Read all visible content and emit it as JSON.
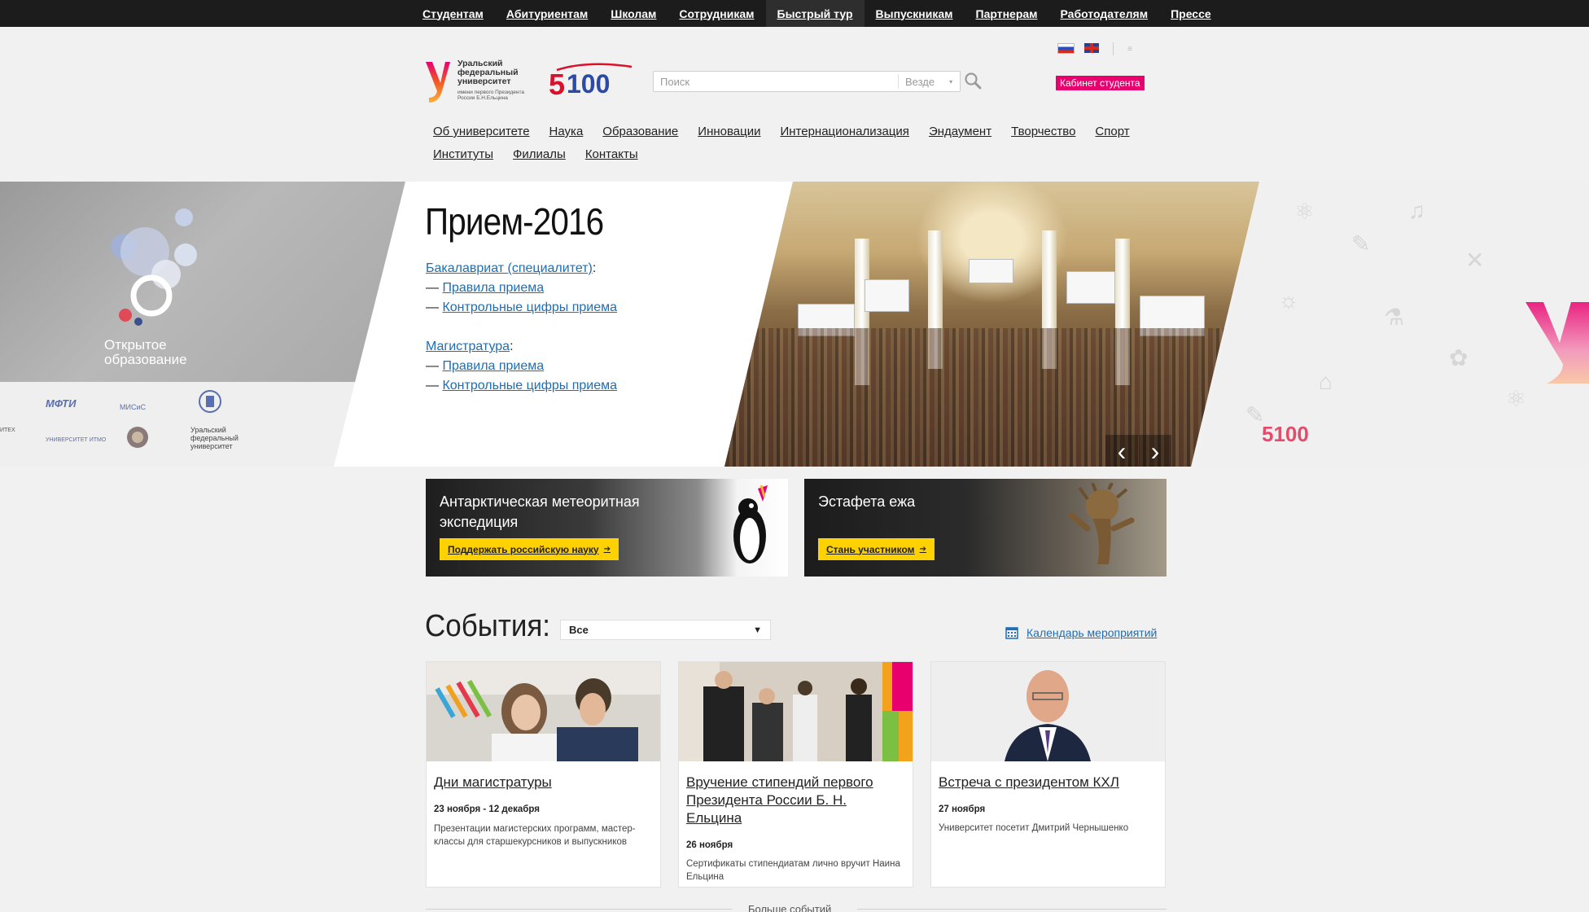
{
  "topbar": {
    "items": [
      {
        "label": "Студентам"
      },
      {
        "label": "Абитуриентам"
      },
      {
        "label": "Школам"
      },
      {
        "label": "Сотрудникам"
      },
      {
        "label": "Быстрый тур"
      },
      {
        "label": "Выпускникам"
      },
      {
        "label": "Партнерам"
      },
      {
        "label": "Работодателям"
      },
      {
        "label": "Прессе"
      }
    ]
  },
  "header": {
    "logo_text": "Уральский федеральный университет",
    "logo_subtext": "имени первого Президента России Б.Н.Ельцина",
    "search_placeholder": "Поиск",
    "search_scope": "Везде",
    "cabinet_label": "Кабинет студента",
    "brand_color": "#e8006e"
  },
  "main_nav": {
    "items": [
      {
        "label": "Об университете"
      },
      {
        "label": "Наука"
      },
      {
        "label": "Образование"
      },
      {
        "label": "Инновации"
      },
      {
        "label": "Интернационализация"
      },
      {
        "label": "Эндаумент"
      },
      {
        "label": "Творчество"
      },
      {
        "label": "Спорт"
      },
      {
        "label": "Институты"
      },
      {
        "label": "Филиалы"
      },
      {
        "label": "Контакты"
      }
    ]
  },
  "hero": {
    "open_edu_title": "Открытое образование",
    "partners": [
      "МФТИ",
      "МИСиС",
      "УНИВЕРСИТЕТ ИТМО",
      "Уральский федеральный университет",
      "ИТЕХ"
    ],
    "title": "Прием-2016",
    "bachelor_label": "Бакалавриат (специалитет)",
    "master_label": "Магистратура",
    "colon": ":",
    "dash": "—",
    "rules_label": "Правила приема",
    "figures_label": "Контрольные цифры приема",
    "prev_label": "‹",
    "next_label": "›",
    "right_badge": "5100"
  },
  "promos": [
    {
      "title": "Антарктическая метеоритная экспедиция",
      "button": "Поддержать российскую науку"
    },
    {
      "title": "Эстафета ежа",
      "button": "Стань участником"
    }
  ],
  "events": {
    "title": "События:",
    "filter_value": "Все",
    "calendar_label": "Календарь мероприятий",
    "more_label": "Больше событий",
    "items": [
      {
        "title": "Дни магистратуры",
        "date": "23 ноября  - 12 декабря",
        "desc": "Презентации магистерских программ, мастер-классы для старшекурсников и выпускников"
      },
      {
        "title": "Вручение стипендий первого Президента России Б. Н. Ельцина",
        "date": "26 ноября",
        "desc": "Сертификаты стипендиатам лично вручит Наина Ельцина"
      },
      {
        "title": "Встреча с президентом КХЛ",
        "date": "27 ноября",
        "desc": "Университет посетит Дмитрий Чернышенко"
      }
    ]
  },
  "colors": {
    "link": "#1c6eb7",
    "promo_button": "#fed100",
    "topbar": "#1c1c1c"
  }
}
